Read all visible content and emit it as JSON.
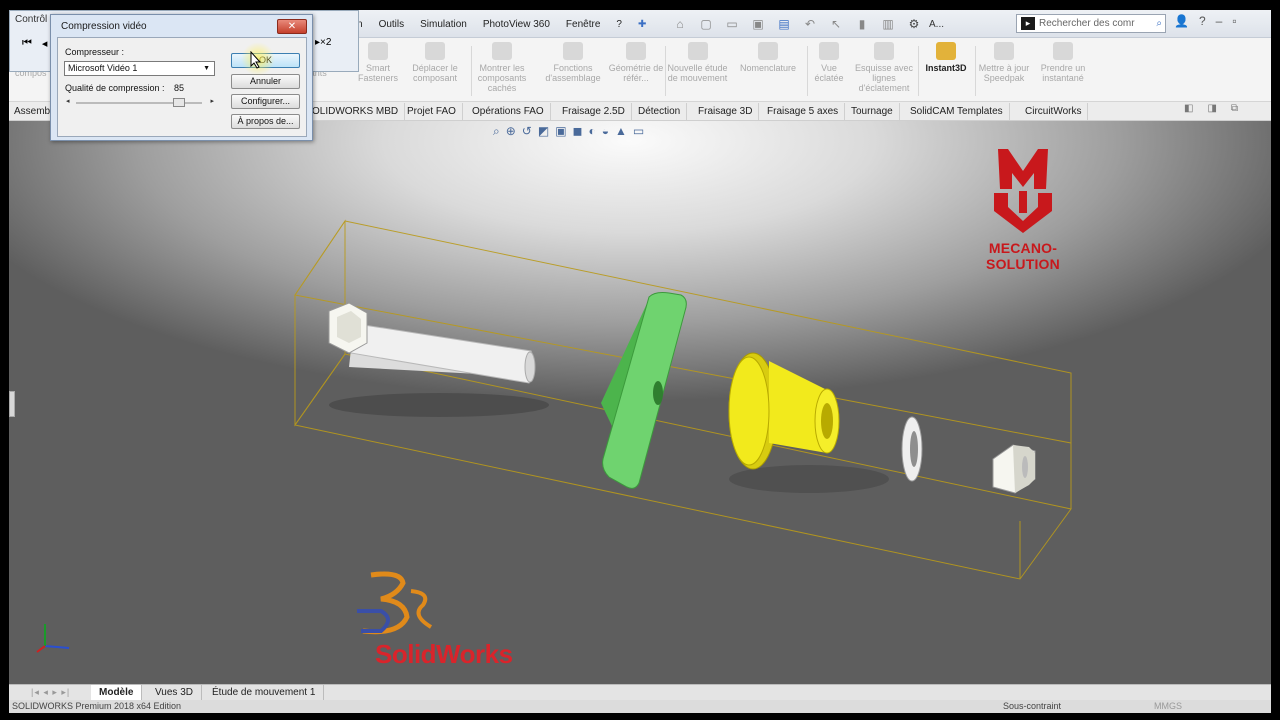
{
  "menu": [
    "n",
    "Outils",
    "Simulation",
    "PhotoView 360",
    "Fenêtre",
    "?"
  ],
  "search": {
    "placeholder": "Rechercher des comr"
  },
  "top_right": {
    "user": "A..."
  },
  "ribbon": [
    {
      "label": "Smart Fasteners",
      "active": false
    },
    {
      "label": "Déplacer le composant",
      "active": false
    },
    {
      "label": "Montrer les composants cachés",
      "active": false
    },
    {
      "label": "Fonctions d'assemblage",
      "active": false
    },
    {
      "label": "Géométrie de référ...",
      "active": false
    },
    {
      "label": "Nouvelle étude de mouvement",
      "active": false
    },
    {
      "label": "Nomenclature",
      "active": false
    },
    {
      "label": "Vue éclatée",
      "active": false
    },
    {
      "label": "Esquisse avec lignes d'éclatement",
      "active": false
    },
    {
      "label": "Instant3D",
      "active": true
    },
    {
      "label": "Mettre à jour Speedpak",
      "active": false
    },
    {
      "label": "Prendre un instantané",
      "active": false
    }
  ],
  "ribbon_left_fragments": {
    "compos": "compos",
    "sants": "sants"
  },
  "tabs": [
    "Assemb",
    "OLIDWORKS MBD",
    "Projet FAO",
    "Opérations FAO",
    "Fraisage 2.5D",
    "Détection",
    "Fraisage 3D",
    "Fraisage 5 axes",
    "Tournage",
    "SolidCAM Templates",
    "CircuitWorks"
  ],
  "motion_controller": {
    "title": "Contrôl",
    "speed": "▸×2"
  },
  "dialog": {
    "title": "Compression vidéo",
    "close": "✕",
    "compressor_label": "Compresseur :",
    "compressor_value": "Microsoft Vidéo 1",
    "quality_label": "Qualité de compression :",
    "quality_value": "85",
    "quality_fraction": 0.85,
    "buttons": {
      "ok": "OK",
      "cancel": "Annuler",
      "configure": "Configurer...",
      "about": "À propos de..."
    }
  },
  "logos": {
    "mecano": "MECANO-SOLUTION",
    "solidworks": "SolidWorks"
  },
  "bottom_tabs": [
    {
      "label": "Modèle",
      "selected": true
    },
    {
      "label": "Vues 3D",
      "selected": false
    },
    {
      "label": "Étude de mouvement 1",
      "selected": false
    }
  ],
  "status": {
    "left": "SOLIDWORKS Premium 2018 x64 Edition",
    "middle": "Sous-contraint",
    "right": "MMGS"
  },
  "colors": {
    "green_part": "#6fd36f",
    "yellow_part": "#f2ea1c",
    "bounding_box": "#b99a1a",
    "brand_red": "#c8181c"
  }
}
